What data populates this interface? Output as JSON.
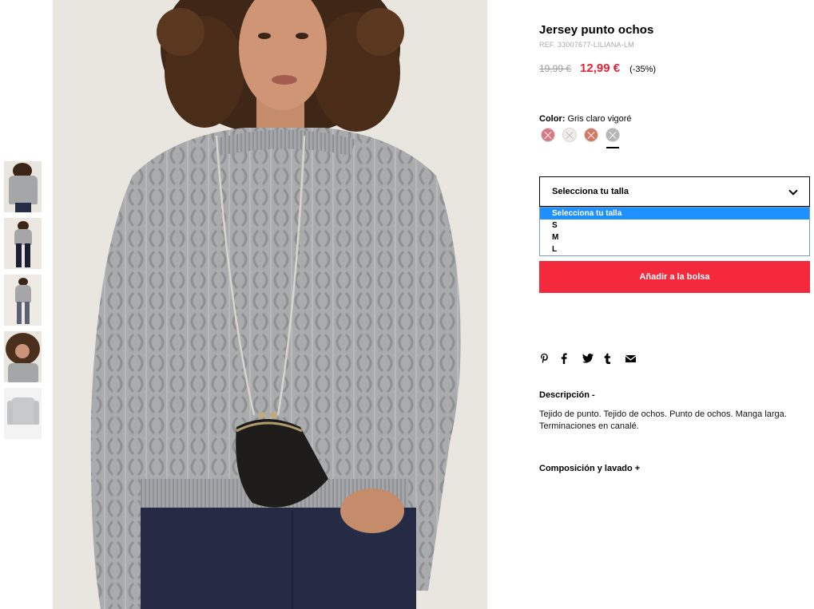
{
  "thumbnails": [
    {
      "label": "thumb-1"
    },
    {
      "label": "thumb-2"
    },
    {
      "label": "thumb-3"
    },
    {
      "label": "thumb-4"
    },
    {
      "label": "thumb-5"
    }
  ],
  "product": {
    "title": "Jersey punto ochos",
    "ref": "REF. 33007677-LILIANA-LM",
    "old_price": "19,99 €",
    "new_price": "12,99 €",
    "discount": "(-35%)"
  },
  "color": {
    "label": "Color:",
    "value": "Gris claro vigoré",
    "swatches": [
      {
        "name": "rosa",
        "hex": "#d57a85"
      },
      {
        "name": "crudo",
        "hex": "#efedea"
      },
      {
        "name": "teja",
        "hex": "#cf7a64"
      },
      {
        "name": "gris claro vigoré",
        "hex": "#b5b6b8",
        "selected": true
      }
    ]
  },
  "size": {
    "placeholder": "Selecciona tu talla",
    "options": [
      "Selecciona tu talla",
      "S",
      "M",
      "L"
    ],
    "highlighted_index": 0
  },
  "add_to_bag": "Añadir a la bolsa",
  "share": [
    "pinterest-icon",
    "facebook-icon",
    "twitter-icon",
    "tumblr-icon",
    "email-icon"
  ],
  "description": {
    "heading": "Descripción -",
    "text": "Tejido de punto. Tejido de ochos. Punto de ochos. Manga larga. Terminaciones en canalé."
  },
  "composition": {
    "heading": "Composición y lavado +"
  },
  "colors": {
    "accent_red": "#f42a3c",
    "price_red": "#e3233a",
    "select_highlight": "#1e90ff"
  }
}
